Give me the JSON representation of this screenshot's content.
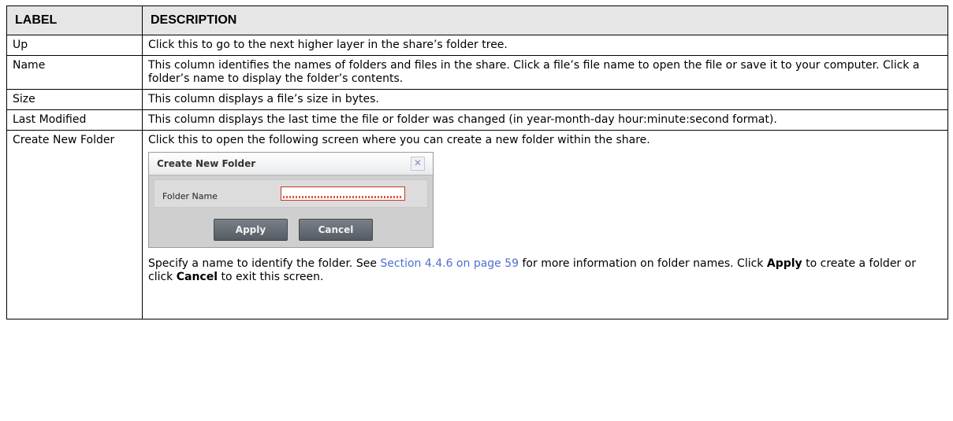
{
  "table": {
    "header": {
      "label": "LABEL",
      "description": "DESCRIPTION"
    },
    "rows": [
      {
        "label": "Up",
        "description": "Click this to go to the next higher layer in the share’s folder tree."
      },
      {
        "label": "Name",
        "description": "This column identifies the names of folders and files in the share. Click a file’s file name to open the file or save it to your computer. Click a folder’s name to display the folder’s contents."
      },
      {
        "label": "Size",
        "description": "This column displays a file’s size in bytes."
      },
      {
        "label": "Last Modified",
        "description": "This column displays the last time the file or folder was changed (in year-month-day hour:minute:second format)."
      },
      {
        "label": "Create New Folder",
        "description": "Click this to open the following screen where you can create a new folder within the share."
      }
    ]
  },
  "dialog": {
    "title": "Create New Folder",
    "close_icon": "close-icon",
    "field_label": "Folder Name",
    "field_value": "",
    "apply_label": "Apply",
    "cancel_label": "Cancel"
  },
  "create_note": {
    "part1": "Specify a name to identify the folder. See ",
    "link": "Section 4.4.6 on page 59",
    "part2": " for more information on folder names. Click ",
    "apply": "Apply",
    "part3": " to create a folder or click ",
    "cancel": "Cancel",
    "part4": " to exit this screen."
  },
  "colors": {
    "header_bg": "#e6e6e6",
    "link": "#4f6fcf",
    "button": "#5f656d"
  }
}
